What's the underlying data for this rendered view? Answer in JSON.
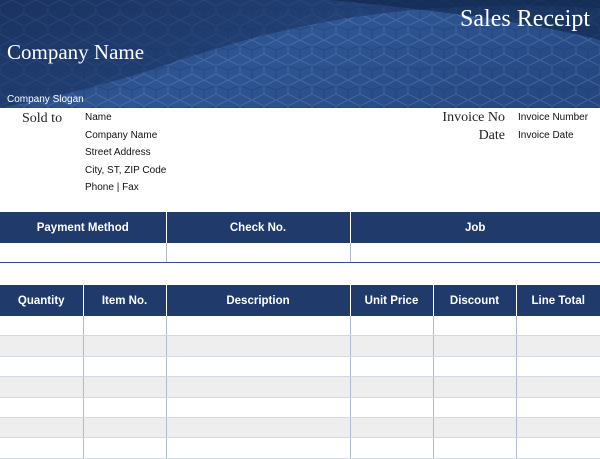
{
  "header": {
    "doc_title": "Sales Receipt",
    "company_name": "Company Name",
    "company_slogan": "Company Slogan"
  },
  "sold_to": {
    "label": "Sold to",
    "lines": [
      "Name",
      "Company Name",
      "Street Address",
      "City, ST,  ZIP Code",
      "Phone  |  Fax"
    ]
  },
  "invoice": {
    "no_label": "Invoice No",
    "no_value": "Invoice Number",
    "date_label": "Date",
    "date_value": "Invoice Date"
  },
  "payment_table": {
    "columns": [
      "Payment Method",
      "Check No.",
      "Job"
    ]
  },
  "items_table": {
    "columns": [
      "Quantity",
      "Item No.",
      "Description",
      "Unit Price",
      "Discount",
      "Line Total"
    ]
  },
  "colors": {
    "header_blue": "#1f3a6b",
    "banner_blue": "#2f5694",
    "row_alt": "#eeeeee"
  }
}
